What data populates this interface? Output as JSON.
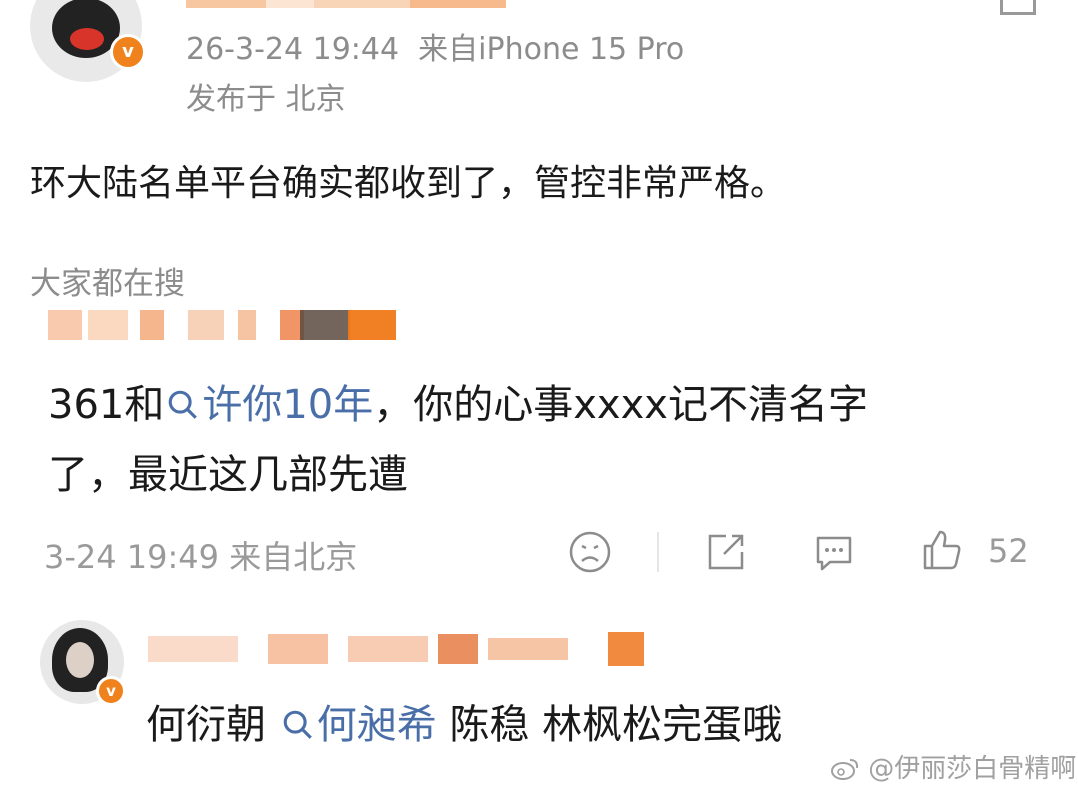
{
  "post": {
    "datetime": "26-3-24 19:44",
    "source": "来自iPhone 15 Pro",
    "location": "发布于 北京",
    "text": "环大陆名单平台确实都收到了，管控非常严格。"
  },
  "search_section": {
    "title": "大家都在搜"
  },
  "comment": {
    "line1_prefix": "361和",
    "line1_link": "许你10年",
    "line1_suffix": "，你的心事xxxx记不清名字",
    "line2": "了，最近这几部先遭",
    "time": "3-24 19:49",
    "location": "来自北京",
    "like_count": "52"
  },
  "reply": {
    "part1": "何衍朝",
    "link": "何昶希",
    "part2": "陈稳 林枫松完蛋哦"
  },
  "watermark": "@伊丽莎白骨精啊",
  "colors": {
    "accent_link": "#4a6fa8",
    "meta_gray": "#8c8c8c",
    "verified_badge": "#f0821e"
  },
  "icons": [
    "verified-icon",
    "favorite-icon",
    "search-icon",
    "sad-face-icon",
    "share-icon",
    "comment-icon",
    "like-icon",
    "weibo-logo-icon"
  ]
}
